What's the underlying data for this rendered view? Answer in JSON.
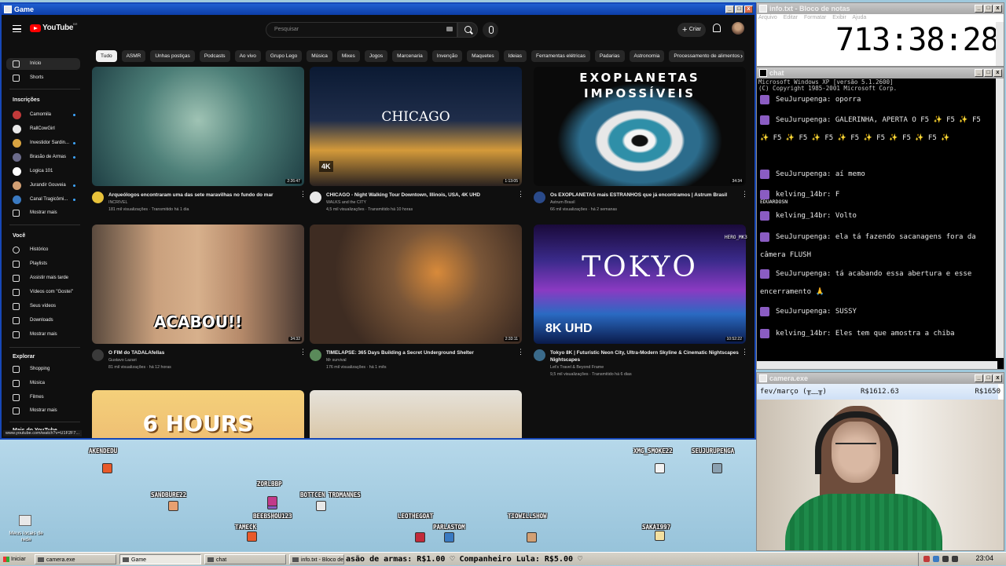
{
  "windows": {
    "game_title": "Game",
    "timer_title": "info.txt - Bloco de notas",
    "chat_title": "chat",
    "camera_title": "camera.exe"
  },
  "youtube": {
    "logo_text": "YouTube",
    "logo_sup": "BR",
    "search_placeholder": "Pesquisar",
    "create_label": "Criar",
    "chips": [
      "Tudo",
      "ASMR",
      "Unhas postiças",
      "Podcasts",
      "Ao vivo",
      "Grupo Lego",
      "Música",
      "Mixes",
      "Jogos",
      "Marcenaria",
      "Invenção",
      "Maquetes",
      "Ideias",
      "Ferramentas elétricas",
      "Padarias",
      "Astronomia",
      "Processamento de alimentos",
      "Cores"
    ],
    "sidebar": {
      "main": [
        {
          "label": "Início",
          "icon": "home-icon"
        },
        {
          "label": "Shorts",
          "icon": "shorts-icon"
        }
      ],
      "subs_header": "Inscrições",
      "subs": [
        {
          "label": "Camomila",
          "color": "#c23a3a"
        },
        {
          "label": "RallCowGirl",
          "color": "#e8e8e8"
        },
        {
          "label": "Investidor Sardin...",
          "color": "#d9a441"
        },
        {
          "label": "Brasão de Armas",
          "color": "#6b6b8a"
        },
        {
          "label": "Logica 101",
          "color": "#ffffff"
        },
        {
          "label": "Jurandir Gouveia",
          "color": "#d2a074"
        },
        {
          "label": "Canal Tragicômi...",
          "color": "#3a7ac2"
        }
      ],
      "subs_more": "Mostrar mais",
      "you_header": "Você",
      "you": [
        {
          "label": "Histórico",
          "icon": "history-icon"
        },
        {
          "label": "Playlists",
          "icon": "playlists-icon"
        },
        {
          "label": "Assistir mais tarde",
          "icon": "watch-later-icon"
        },
        {
          "label": "Vídeos com \"Gostei\"",
          "icon": "like-icon"
        },
        {
          "label": "Seus vídeos",
          "icon": "your-videos-icon"
        },
        {
          "label": "Downloads",
          "icon": "download-icon"
        }
      ],
      "you_more": "Mostrar mais",
      "explore_header": "Explorar",
      "explore": [
        {
          "label": "Shopping",
          "icon": "shopping-icon"
        },
        {
          "label": "Música",
          "icon": "music-icon"
        },
        {
          "label": "Filmes",
          "icon": "film-icon"
        }
      ],
      "explore_more": "Mostrar mais",
      "more_youtube": "Mais do YouTube"
    },
    "videos": [
      {
        "title": "Arqueólogos encontraram uma das sete maravilhas no fundo do mar",
        "channel": "INCRIVEL",
        "meta": "181 mil visualizações · Transmitido há 1 dia",
        "duration": "2:26:47",
        "thumb_text": ""
      },
      {
        "title": "CHICAGO - Night Walking Tour Downtown, Illinois, USA, 4K UHD",
        "channel": "WALKS and the CITY",
        "meta": "4,5 mil visualizações · Transmitido há 10 horas",
        "duration": "1:13:05",
        "thumb_text": "CHICAGO",
        "badge": "4K"
      },
      {
        "title": "Os EXOPLANETAS mais ESTRANHOS que já encontramos | Astrum Brasil",
        "channel": "Astrum Brasil",
        "meta": "66 mil visualizações · há 2 semanas",
        "duration": "34:34",
        "thumb_text": "EXOPLANETAS IMPOSSÍVEIS"
      },
      {
        "title": "O FIM do TADALAfellas",
        "channel": "Gustavo Lazari",
        "meta": "81 mil visualizações · há 12 horas",
        "duration": "34:32",
        "thumb_text": "ACABOU!!"
      },
      {
        "title": "TIMELAPSE: 365 Days Building a Secret Underground Shelter",
        "channel": "Mr survival",
        "meta": "176 mil visualizações · há 1 mês",
        "duration": "2:33:11",
        "thumb_text": ""
      },
      {
        "title": "Tokyo 8K | Futuristic Neon City, Ultra-Modern Skyline & Cinematic Nightscapes",
        "title2": "Nightscapes",
        "channel": "Let's Travel & Beyond Frame",
        "meta": "9,5 mil visualizações · Transmitido há 6 dias",
        "duration": "10:52:22",
        "thumb_text": "TOKYO",
        "badge": "8K UHD"
      },
      {
        "title": "",
        "channel": "",
        "meta": "",
        "duration": "",
        "thumb_text": "6 HOURS"
      },
      {
        "title": "",
        "channel": "",
        "meta": "",
        "duration": "",
        "thumb_text": ""
      }
    ],
    "status_url": "www.youtube.com/watch?v=U1F2F7..."
  },
  "timer": {
    "menu": [
      "Arquivo",
      "Editar",
      "Formatar",
      "Exibir",
      "Ajuda"
    ],
    "value": "713:38:28"
  },
  "chat": {
    "header": [
      "Microsoft Windows XP [versão 5.1.2600]",
      "(C) Copyright 1985-2001 Microsoft Corp."
    ],
    "messages": [
      "SeuJurupenga: oporra",
      "SeuJurupenga: GALERINHA, APERTA O F5 ✨ F5 ✨ F5 ✨ F5 ✨ F5 ✨ F5 ✨ F5 ✨ F5 ✨ F5 ✨ F5 ✨",
      "SeuJurupenga: aí memo",
      "kelving_14br: F",
      "kelving_14br: Volto",
      "SeuJurupenga: ela tá fazendo sacanagens fora da câmera FLUSH",
      "SeuJurupenga: tá acabando essa abertura e esse encerramento 🙏",
      "SeuJurupenga: SUSSY",
      "kelving_14br: Eles tem que amostra a chiba"
    ],
    "overlay_names": [
      "EDUARDOSN",
      "HERO_MK3"
    ]
  },
  "camera": {
    "goal_label": "fev/março (╥﹏╥)",
    "current": "R$1612.63",
    "goal": "R$1650",
    "progress": 0.977
  },
  "stream": {
    "users": [
      {
        "name": "AKENDEDU",
        "color": "#e85a2a"
      },
      {
        "name": "XMG_SMOKE22",
        "color": "#f2f2f2"
      },
      {
        "name": "SEUJURUPENGA",
        "color": "#8aa0b0"
      },
      {
        "name": "ZORLBBP",
        "color": "#8a5cc2"
      },
      {
        "name": "SANDBURE22",
        "color": "#e8a070"
      },
      {
        "name": "BOTTCEN TRDMANNES",
        "color": "#e8e8e8"
      },
      {
        "name": "BEEBSHOU123",
        "color": "#c23a8a"
      },
      {
        "name": "LEOTHEGOAT",
        "color": "#c22a3a"
      },
      {
        "name": "TIOWILLSHOW",
        "color": "#d2a074"
      },
      {
        "name": "TAMECK",
        "color": "#e85a2a"
      },
      {
        "name": "PARLASTOM",
        "color": "#3a7ac2"
      },
      {
        "name": "SAKAI997",
        "color": "#f2e0a0"
      }
    ],
    "desktop_icon_label": "Meus locais de rede"
  },
  "taskbar": {
    "start": "Iniciar",
    "tasks": [
      "camera.exe",
      "Game",
      "chat",
      "info.txt - Bloco de notas"
    ],
    "ticker": "asão de armas: R$1.00 ♡ Companheiro Lula: R$5.00 ♡",
    "clock": "23:04"
  }
}
